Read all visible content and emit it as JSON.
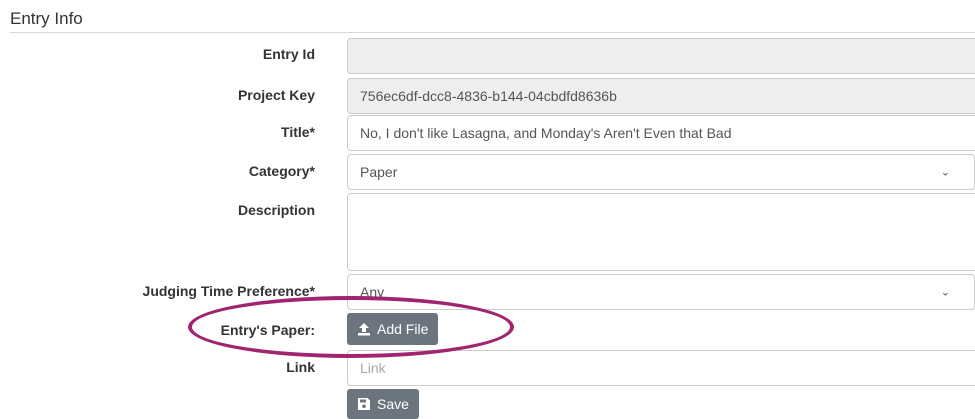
{
  "section": {
    "title": "Entry Info"
  },
  "form": {
    "entry_id": {
      "label": "Entry Id",
      "value": ""
    },
    "project_key": {
      "label": "Project Key",
      "value": "756ec6df-dcc8-4836-b144-04cbdfd8636b"
    },
    "title": {
      "label": "Title*",
      "value": "No, I don't like Lasagna, and Monday's Aren't Even that Bad"
    },
    "category": {
      "label": "Category*",
      "value": "Paper"
    },
    "description": {
      "label": "Description",
      "value": ""
    },
    "judging_time": {
      "label": "Judging Time Preference*",
      "value": "Any"
    },
    "paper": {
      "label": "Entry's Paper:",
      "button": "Add File",
      "icon": "upload-icon"
    },
    "link": {
      "label": "Link",
      "placeholder": "Link"
    },
    "save": {
      "label": "Save",
      "icon": "floppy-disk-icon"
    }
  },
  "annotation": {
    "color": "#a0246e"
  },
  "colors": {
    "button_bg": "#6c757d",
    "readonly_bg": "#eeeeee",
    "border": "#cccccc"
  }
}
